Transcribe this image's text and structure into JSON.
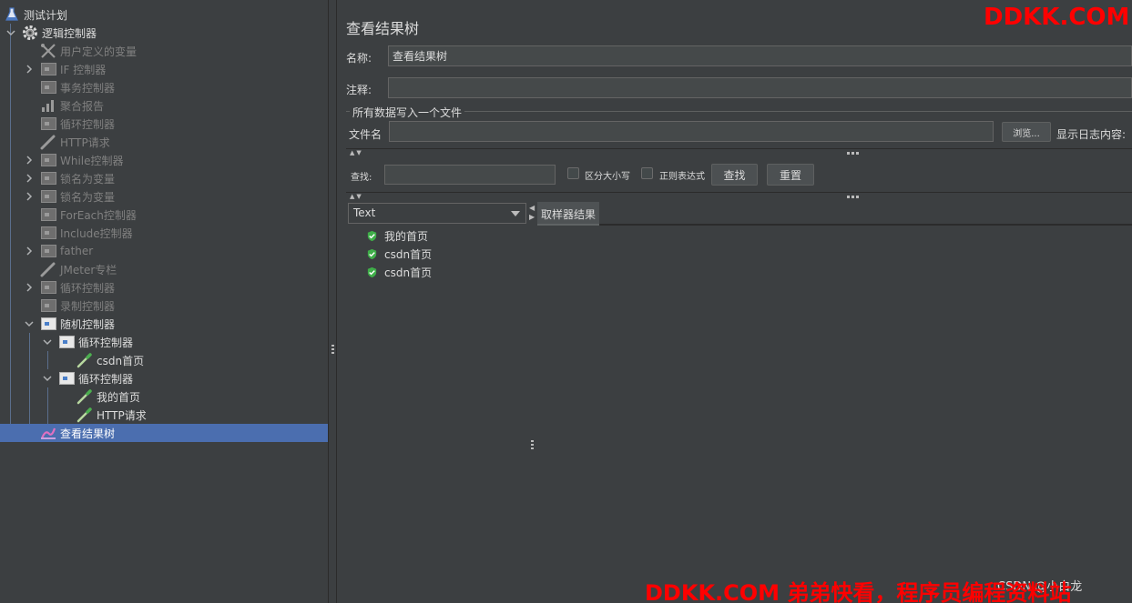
{
  "tree": {
    "nodes": [
      {
        "label": "测试计划",
        "state": "on"
      },
      {
        "label": "逻辑控制器",
        "state": "on"
      },
      {
        "label": "用户定义的变量",
        "state": "off"
      },
      {
        "label": "IF 控制器",
        "state": "off"
      },
      {
        "label": "事务控制器",
        "state": "off"
      },
      {
        "label": "聚合报告",
        "state": "off"
      },
      {
        "label": "循环控制器",
        "state": "off"
      },
      {
        "label": "HTTP请求",
        "state": "off"
      },
      {
        "label": "While控制器",
        "state": "off"
      },
      {
        "label": "锁名为变量",
        "state": "off"
      },
      {
        "label": "锁名为变量",
        "state": "off"
      },
      {
        "label": "ForEach控制器",
        "state": "off"
      },
      {
        "label": "Include控制器",
        "state": "off"
      },
      {
        "label": "father",
        "state": "off"
      },
      {
        "label": "JMeter专栏",
        "state": "off"
      },
      {
        "label": "循环控制器",
        "state": "off"
      },
      {
        "label": "录制控制器",
        "state": "off"
      },
      {
        "label": "随机控制器",
        "state": "on"
      },
      {
        "label": "循环控制器",
        "state": "on"
      },
      {
        "label": "csdn首页",
        "state": "on"
      },
      {
        "label": "循环控制器",
        "state": "on"
      },
      {
        "label": "我的首页",
        "state": "on"
      },
      {
        "label": "HTTP请求",
        "state": "on"
      },
      {
        "label": "查看结果树",
        "state": "selected"
      }
    ]
  },
  "panel": {
    "title": "查看结果树",
    "name_label": "名称:",
    "name_value": "查看结果树",
    "comment_label": "注释:",
    "comment_value": "",
    "file_group_title": "所有数据写入一个文件",
    "file_label": "文件名",
    "file_value": "",
    "browse_button": "浏览...",
    "log_display_label": "显示日志内容:",
    "search_label": "查找:",
    "search_value": "",
    "case_sensitive_label": "区分大小写",
    "regex_label": "正则表达式",
    "find_button": "查找",
    "reset_button": "重置",
    "renderer_selected": "Text",
    "results": [
      "我的首页",
      "csdn首页",
      "csdn首页"
    ],
    "sampler_tab": "取样器结果"
  },
  "watermark": {
    "top": "DDKK.COM",
    "bottom": "DDKK.COM 弟弟快看，程序员编程资料站",
    "underlay": "CSDN @小白龙"
  },
  "colors": {
    "background": "#3c3f41",
    "selection": "#4b6eaf",
    "ok_green": "#3fae49",
    "watermark_red": "#ff0000"
  }
}
